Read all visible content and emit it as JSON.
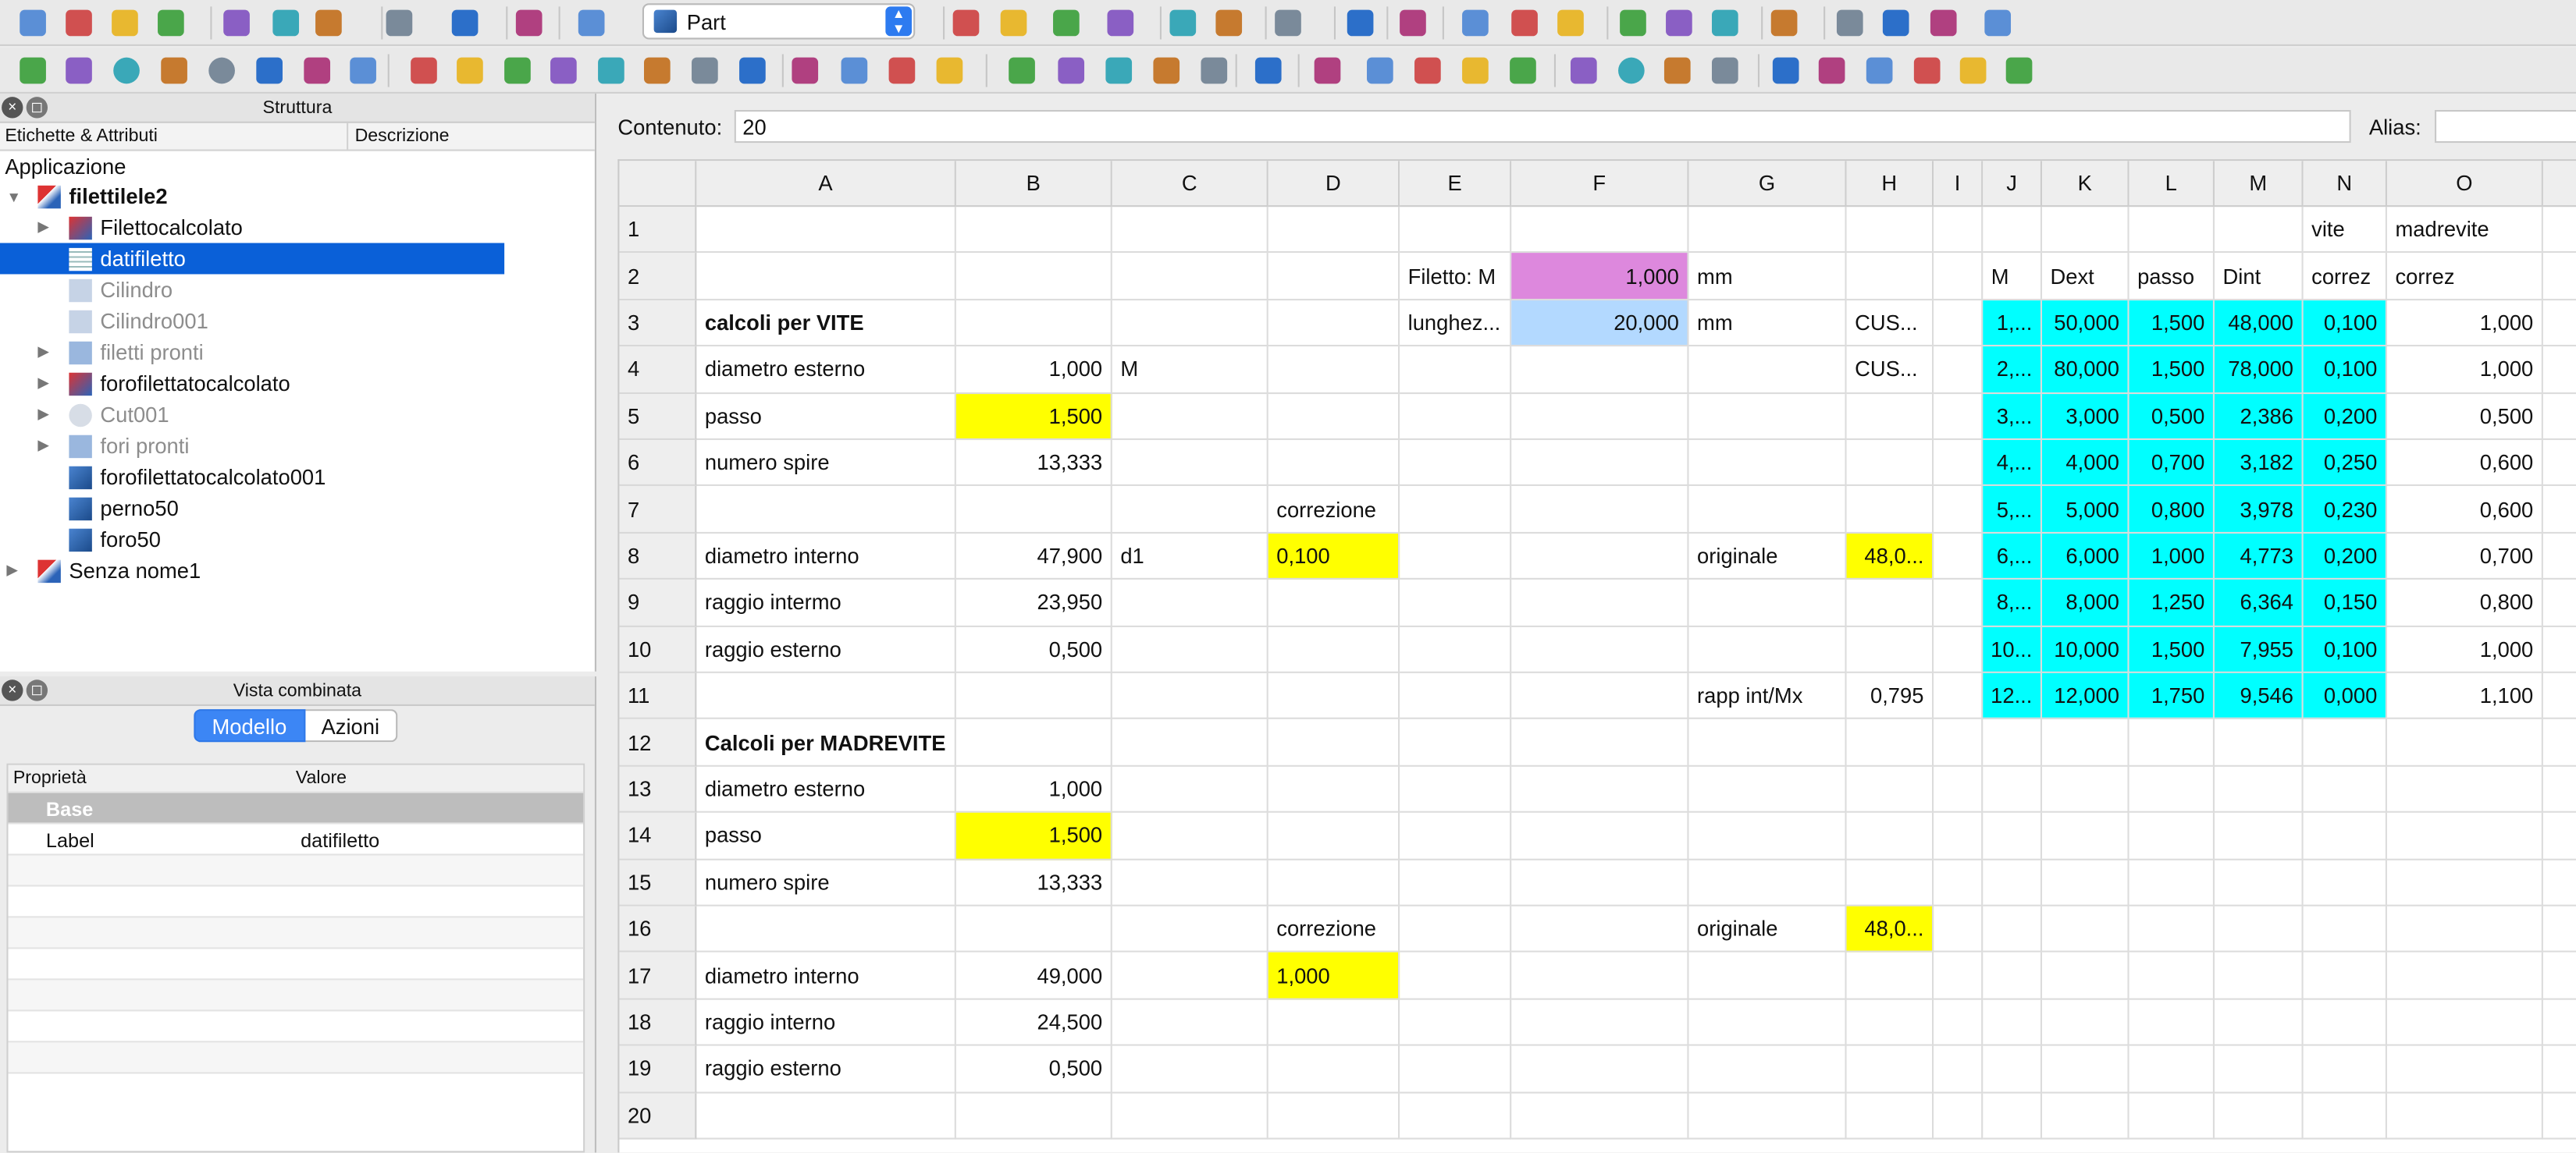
{
  "colors": {
    "yellow": "#ffff00",
    "cyan": "#00ffff",
    "pink": "#dd88dd",
    "lightblue": "#b3d9ff",
    "selection": "#0a60d8"
  },
  "toolbar": {
    "workbench": "Part",
    "row1_icons": [
      "new-file-icon",
      "open-file-icon",
      "save-icon",
      "save-as-icon",
      "cut-icon",
      "copy-icon",
      "paste-icon",
      "undo-icon",
      "redo-icon",
      "refresh-icon",
      "whats-this-icon",
      "fit-all-icon",
      "zoom-icon",
      "draw-style-icon",
      "bounding-box-icon",
      "back-icon",
      "forward-icon",
      "sync-view-icon",
      "view-zoom-icon",
      "isometric-icon",
      "front-view-icon",
      "top-view-icon",
      "right-view-icon",
      "rear-view-icon",
      "bottom-view-icon",
      "left-view-icon",
      "measure-icon",
      "part-icon",
      "group-icon",
      "link-icon",
      "link-actions-icon"
    ],
    "row2_icons": [
      "box-icon",
      "cylinder-icon",
      "sphere-icon",
      "cone-icon",
      "torus-icon",
      "tube-icon",
      "primitives-icon",
      "shape-builder-icon",
      "extrude-icon",
      "revolve-icon",
      "mirror-icon",
      "fillet-icon",
      "chamfer-icon",
      "make-face-icon",
      "ruled-surface-icon",
      "loft-icon",
      "sweep-icon",
      "section-icon",
      "cross-sections-icon",
      "offset-icon",
      "thickness-icon",
      "projection-icon",
      "compound-icon",
      "boolean-icon",
      "cut-icon",
      "fuse-icon",
      "common-icon",
      "join-icon",
      "split-icon",
      "check-geometry-icon",
      "defeaturing-icon",
      "refine-icon",
      "macro-record-icon",
      "macro-stop-icon",
      "macro-edit-icon",
      "macro-run-icon",
      "spreadsheet-add-icon",
      "spreadsheet-import-icon",
      "spreadsheet-export-icon",
      "spreadsheet-merge-icon",
      "spreadsheet-split-icon",
      "spreadsheet-alias-icon"
    ]
  },
  "structure": {
    "title": "Struttura",
    "col1": "Etichette & Attributi",
    "col2": "Descrizione",
    "root": "Applicazione",
    "items": [
      {
        "label": "filettilele2",
        "bold": true,
        "level": 0,
        "expander": "▼"
      },
      {
        "label": "Filettocalcolato",
        "level": 1,
        "expander": "▶"
      },
      {
        "label": "datifiletto",
        "level": 1,
        "selected": true
      },
      {
        "label": "Cilindro",
        "level": 1,
        "grey": true
      },
      {
        "label": "Cilindro001",
        "level": 1,
        "grey": true
      },
      {
        "label": "filetti pronti",
        "level": 1,
        "grey": true,
        "expander": "▶"
      },
      {
        "label": "forofilettatocalcolato",
        "level": 1,
        "expander": "▶"
      },
      {
        "label": "Cut001",
        "level": 1,
        "grey": true,
        "expander": "▶"
      },
      {
        "label": "fori pronti",
        "level": 1,
        "grey": true,
        "expander": "▶"
      },
      {
        "label": "forofilettatocalcolato001",
        "level": 1
      },
      {
        "label": "perno50",
        "level": 1
      },
      {
        "label": "foro50",
        "level": 1
      },
      {
        "label": "Senza nome1",
        "level": 0,
        "expander": "▶"
      }
    ]
  },
  "combo": {
    "title": "Vista combinata",
    "tab_model": "Modello",
    "tab_actions": "Azioni",
    "col_property": "Proprietà",
    "col_value": "Valore",
    "group": "Base",
    "prop_label": "Label",
    "prop_value": "datifiletto"
  },
  "sheet": {
    "content_label": "Contenuto:",
    "content_value": "20",
    "alias_label": "Alias:",
    "columns": [
      "A",
      "B",
      "C",
      "D",
      "E",
      "F",
      "G",
      "H",
      "I",
      "J",
      "K",
      "L",
      "M",
      "N",
      "O"
    ],
    "rows": [
      {
        "n": "1",
        "cells": {
          "N": "vite",
          "O": "madrevite"
        }
      },
      {
        "n": "2",
        "cells": {
          "E": "Filetto: M",
          "F": "1,000",
          "G": "mm",
          "J": "M",
          "K": "Dext",
          "L": "passo",
          "M": "Dint",
          "N": "correz",
          "O": "correz"
        }
      },
      {
        "n": "3",
        "cells": {
          "A": "calcoli per VITE",
          "E": "lunghez...",
          "F": "20,000",
          "G": "mm",
          "H": "CUS...",
          "J": "1,...",
          "K": "50,000",
          "L": "1,500",
          "M": "48,000",
          "N": "0,100",
          "O": "1,000"
        }
      },
      {
        "n": "4",
        "cells": {
          "A": "diametro esterno",
          "B": "1,000",
          "C": "M",
          "H": "CUS...",
          "J": "2,...",
          "K": "80,000",
          "L": "1,500",
          "M": "78,000",
          "N": "0,100",
          "O": "1,000"
        }
      },
      {
        "n": "5",
        "cells": {
          "A": "passo",
          "B": "1,500",
          "J": "3,...",
          "K": "3,000",
          "L": "0,500",
          "M": "2,386",
          "N": "0,200",
          "O": "0,500"
        }
      },
      {
        "n": "6",
        "cells": {
          "A": "numero spire",
          "B": "13,333",
          "J": "4,...",
          "K": "4,000",
          "L": "0,700",
          "M": "3,182",
          "N": "0,250",
          "O": "0,600"
        }
      },
      {
        "n": "7",
        "cells": {
          "D": "correzione",
          "J": "5,...",
          "K": "5,000",
          "L": "0,800",
          "M": "3,978",
          "N": "0,230",
          "O": "0,600"
        }
      },
      {
        "n": "8",
        "cells": {
          "A": "diametro interno",
          "B": "47,900",
          "C": "d1",
          "D": "0,100",
          "G": "originale",
          "H": "48,0...",
          "J": "6,...",
          "K": "6,000",
          "L": "1,000",
          "M": "4,773",
          "N": "0,200",
          "O": "0,700"
        }
      },
      {
        "n": "9",
        "cells": {
          "A": "raggio intermo",
          "B": "23,950",
          "J": "8,...",
          "K": "8,000",
          "L": "1,250",
          "M": "6,364",
          "N": "0,150",
          "O": "0,800"
        }
      },
      {
        "n": "10",
        "cells": {
          "A": "raggio esterno",
          "B": "0,500",
          "J": "10...",
          "K": "10,000",
          "L": "1,500",
          "M": "7,955",
          "N": "0,100",
          "O": "1,000"
        }
      },
      {
        "n": "11",
        "cells": {
          "G": "rapp int/Mx",
          "H": "0,795",
          "J": "12...",
          "K": "12,000",
          "L": "1,750",
          "M": "9,546",
          "N": "0,000",
          "O": "1,100"
        }
      },
      {
        "n": "12",
        "cells": {
          "A": "Calcoli per MADREVITE"
        }
      },
      {
        "n": "13",
        "cells": {
          "A": "diametro esterno",
          "B": "1,000"
        }
      },
      {
        "n": "14",
        "cells": {
          "A": "passo",
          "B": "1,500"
        }
      },
      {
        "n": "15",
        "cells": {
          "A": "numero spire",
          "B": "13,333"
        }
      },
      {
        "n": "16",
        "cells": {
          "D": "correzione",
          "G": "originale",
          "H": "48,0..."
        }
      },
      {
        "n": "17",
        "cells": {
          "A": "diametro interno",
          "B": "49,000",
          "D": "1,000"
        }
      },
      {
        "n": "18",
        "cells": {
          "A": "raggio interno",
          "B": "24,500"
        }
      },
      {
        "n": "19",
        "cells": {
          "A": "raggio esterno",
          "B": "0,500"
        }
      },
      {
        "n": "20",
        "cells": {}
      }
    ],
    "highlights": {
      "yellow": [
        "B5",
        "D8",
        "H8",
        "B14",
        "H16",
        "D17"
      ],
      "pink": [
        "F2"
      ],
      "lightblue": [
        "F3"
      ],
      "cyan_cols": [
        "J",
        "K",
        "L",
        "M",
        "N"
      ],
      "cyan_rows": [
        3,
        11
      ]
    },
    "bold_cells": [
      "A3",
      "A12"
    ],
    "number_cells": [
      "B",
      "F",
      "H",
      "J",
      "K",
      "L",
      "M",
      "N",
      "O"
    ]
  }
}
